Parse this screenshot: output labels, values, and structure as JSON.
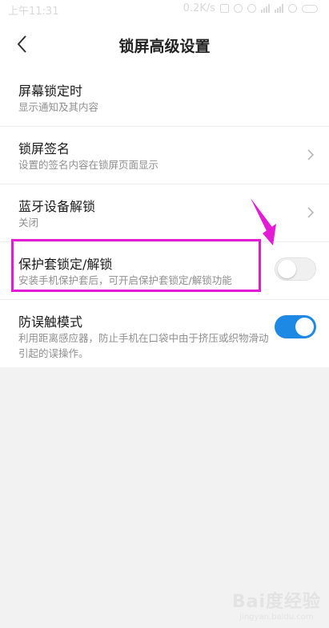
{
  "status_bar": {
    "time": "上午11:31",
    "net_speed": "0.2K/s",
    "battery": "79"
  },
  "header": {
    "title": "锁屏高级设置"
  },
  "settings": [
    {
      "title": "屏幕锁定时",
      "subtitle": "显示通知及其内容",
      "control": "none"
    },
    {
      "title": "锁屏签名",
      "subtitle": "设置的签名内容在锁屏页面显示",
      "control": "chevron"
    },
    {
      "title": "蓝牙设备解锁",
      "subtitle": "关闭",
      "control": "chevron"
    },
    {
      "title": "保护套锁定/解锁",
      "subtitle": "安装手机保护套后，可开启保护套锁定/解锁功能",
      "control": "toggle",
      "state": "off"
    },
    {
      "title": "防误触模式",
      "subtitle": "利用距离感应器，防止手机在口袋中由于挤压或织物滑动引起的误操作。",
      "control": "toggle",
      "state": "on"
    }
  ],
  "colors": {
    "toggle_on": "#1e88e5",
    "annotation": "#e31bd4"
  },
  "watermark": {
    "logo": "Bai度经验",
    "url": "jingyan.baidu.com"
  }
}
